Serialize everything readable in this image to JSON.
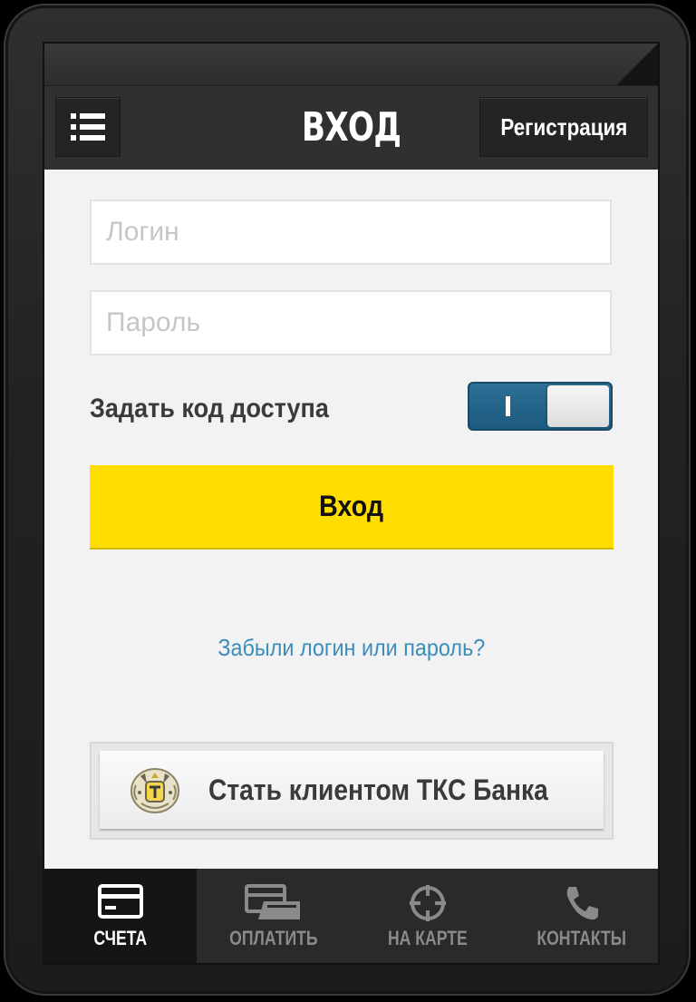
{
  "header": {
    "title": "ВХОД",
    "register_label": "Регистрация"
  },
  "form": {
    "login_placeholder": "Логин",
    "login_value": "",
    "password_placeholder": "Пароль",
    "password_value": "",
    "passcode_label": "Задать код доступа",
    "passcode_toggle_on": true,
    "login_button_label": "Вход",
    "forgot_link": "Забыли логин или пароль?",
    "become_client_label": "Стать клиентом ТКС Банка"
  },
  "tabbar": {
    "tabs": [
      {
        "label": "СЧЕТА",
        "icon": "card-icon",
        "active": true
      },
      {
        "label": "ОПЛАТИТЬ",
        "icon": "payment-icon",
        "active": false
      },
      {
        "label": "НА КАРТЕ",
        "icon": "map-target-icon",
        "active": false
      },
      {
        "label": "КОНТАКТЫ",
        "icon": "phone-icon",
        "active": false
      }
    ]
  },
  "colors": {
    "accent_yellow": "#ffdd00",
    "link_blue": "#3b8dba",
    "toggle_blue": "#1d5a80",
    "header_dark": "#303030"
  }
}
